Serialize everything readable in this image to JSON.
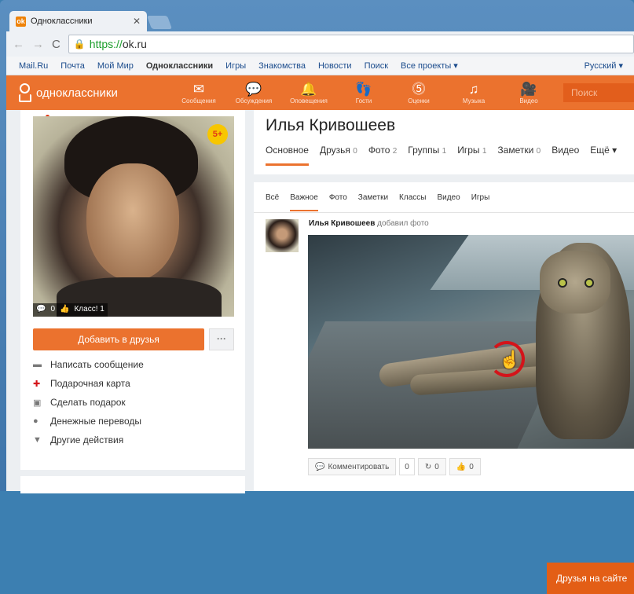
{
  "browser": {
    "tab_title": "Одноклассники",
    "tab_favicon": "ok-favicon",
    "url_scheme": "https://",
    "url_host": "ok.ru"
  },
  "portal": {
    "links": [
      "Mail.Ru",
      "Почта",
      "Мой Мир",
      "Одноклассники",
      "Игры",
      "Знакомства",
      "Новости",
      "Поиск",
      "Все проекты ▾"
    ],
    "language": "Русский ▾"
  },
  "ok_header": {
    "logo_text": "одноклассники",
    "nav": [
      {
        "label": "Сообщения",
        "icon": "envelope-icon"
      },
      {
        "label": "Обсуждения",
        "icon": "chat-icon"
      },
      {
        "label": "Оповещения",
        "icon": "bell-icon"
      },
      {
        "label": "Гости",
        "icon": "footprints-icon"
      },
      {
        "label": "Оценки",
        "icon": "ratings-icon"
      },
      {
        "label": "Музыка",
        "icon": "music-icon"
      },
      {
        "label": "Видео",
        "icon": "video-icon"
      }
    ],
    "search_placeholder": "Поиск"
  },
  "profile": {
    "name": "Илья Кривошеев",
    "age_badge": "5+",
    "photo_stats": {
      "comments": "0",
      "likes": "Класс! 1"
    },
    "add_friend": "Добавить в друзья",
    "more": "···",
    "actions": [
      {
        "label": "Написать сообщение",
        "icon": "message-icon"
      },
      {
        "label": "Подарочная карта",
        "icon": "gift-card-icon"
      },
      {
        "label": "Сделать подарок",
        "icon": "gift-icon"
      },
      {
        "label": "Денежные переводы",
        "icon": "money-icon"
      },
      {
        "label": "Другие действия",
        "icon": "chevron-down-icon"
      }
    ],
    "tabs": [
      {
        "label": "Основное",
        "count": ""
      },
      {
        "label": "Друзья",
        "count": "0"
      },
      {
        "label": "Фото",
        "count": "2"
      },
      {
        "label": "Группы",
        "count": "1"
      },
      {
        "label": "Игры",
        "count": "1"
      },
      {
        "label": "Заметки",
        "count": "0"
      },
      {
        "label": "Видео",
        "count": ""
      },
      {
        "label": "Ещё ▾",
        "count": ""
      }
    ]
  },
  "feed": {
    "tabs": [
      "Всё",
      "Важное",
      "Фото",
      "Заметки",
      "Классы",
      "Видео",
      "Игры"
    ],
    "post": {
      "author": "Илья Кривошеев",
      "action": "добавил фото",
      "comment_label": "Комментировать",
      "comment_count": "0",
      "share_count": "0",
      "like_count": "0"
    }
  },
  "friends_online": "Друзья на сайте"
}
